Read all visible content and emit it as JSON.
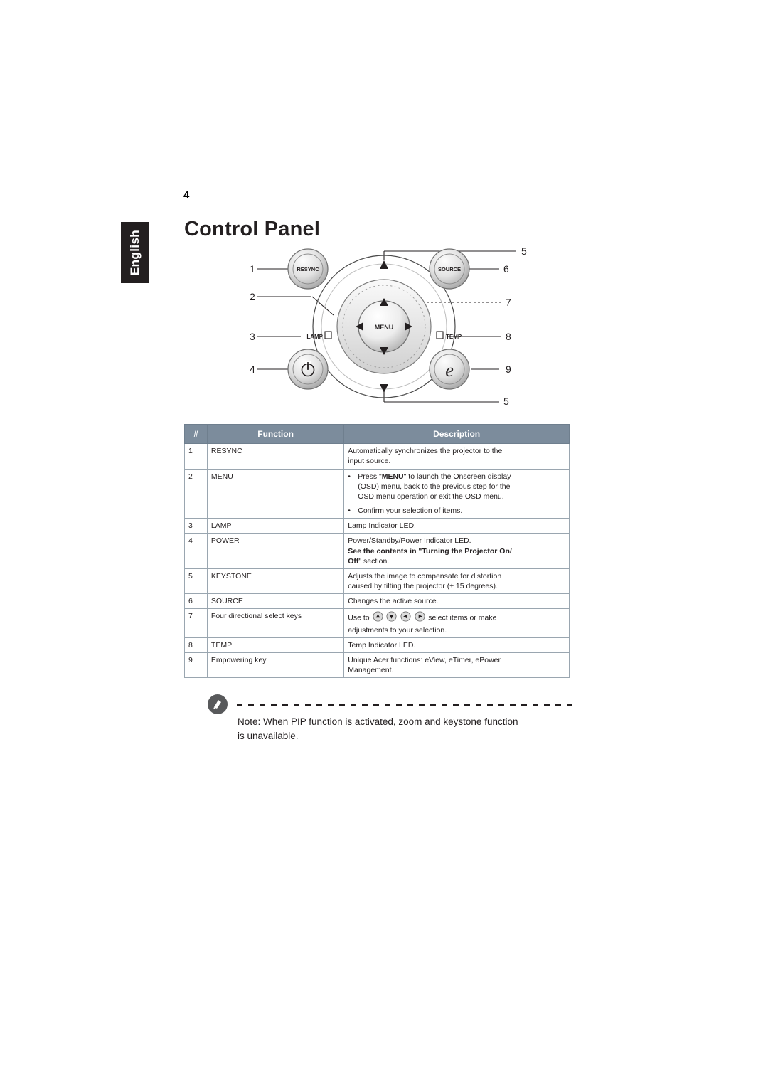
{
  "page": {
    "number": "4",
    "language_tab": "English",
    "title": "Control Panel"
  },
  "figure": {
    "name": "control-panel-diagram",
    "callouts_left": [
      "1",
      "2",
      "3",
      "4"
    ],
    "callouts_right": [
      "5",
      "6",
      "7",
      "8",
      "9",
      "5"
    ],
    "buttons": {
      "resync": "RESYNC",
      "source": "SOURCE",
      "menu": "MENU",
      "lamp": "LAMP",
      "temp": "TEMP",
      "empowering": "e",
      "power": "power-symbol"
    }
  },
  "table": {
    "headers": {
      "num": "#",
      "function": "Function",
      "description": "Description"
    },
    "rows": [
      {
        "num": "1",
        "function": "RESYNC",
        "desc_lines": [
          "Automatically synchronizes the projector to the",
          "input source."
        ]
      },
      {
        "num": "2",
        "function": "MENU",
        "bullets": [
          "Press \"MENU\" to launch the Onscreen display (OSD) menu, back to the previous step for the OSD menu operation or exit the OSD menu.",
          "Confirm your selection of items."
        ],
        "bullet1_line1_pre": "Press \"",
        "bullet1_line1_bold": "MENU",
        "bullet1_line1_post": "\" to launch the Onscreen display",
        "bullet1_line2": "(OSD) menu, back to the previous step for the",
        "bullet1_line3": "OSD menu operation or exit the OSD menu.",
        "bullet2": "Confirm your selection of items."
      },
      {
        "num": "3",
        "function": "LAMP",
        "desc_lines": [
          "Lamp Indicator LED."
        ]
      },
      {
        "num": "4",
        "function": "POWER",
        "desc_lines": [
          "Power/Standby/Power Indicator LED."
        ],
        "desc_bold_line1": "See the contents in \"Turning the Projector On/",
        "desc_bold_line2_bold": "Off",
        "desc_bold_line2_rest": "\" section."
      },
      {
        "num": "5",
        "function": "KEYSTONE",
        "desc_lines": [
          "Adjusts the image to compensate for distortion",
          "caused by tilting the projector (± 15 degrees)."
        ]
      },
      {
        "num": "6",
        "function": "SOURCE",
        "desc_lines": [
          "Changes the active source."
        ]
      },
      {
        "num": "7",
        "function": "Four directional select keys",
        "desc_prefix": "Use to",
        "desc_suffix": "select items or make",
        "desc_line2": "adjustments to your selection."
      },
      {
        "num": "8",
        "function": "TEMP",
        "desc_lines": [
          "Temp Indicator LED."
        ]
      },
      {
        "num": "9",
        "function": "Empowering key",
        "desc_lines": [
          "Unique Acer functions: eView, eTimer, ePower",
          "Management."
        ]
      }
    ]
  },
  "note": {
    "line1": "Note: When PIP function is activated, zoom and keystone function",
    "line2": "is unavailable."
  },
  "colors": {
    "header_bg": "#7c8c9c",
    "tab_bg": "#231f20",
    "text": "#231f20"
  }
}
